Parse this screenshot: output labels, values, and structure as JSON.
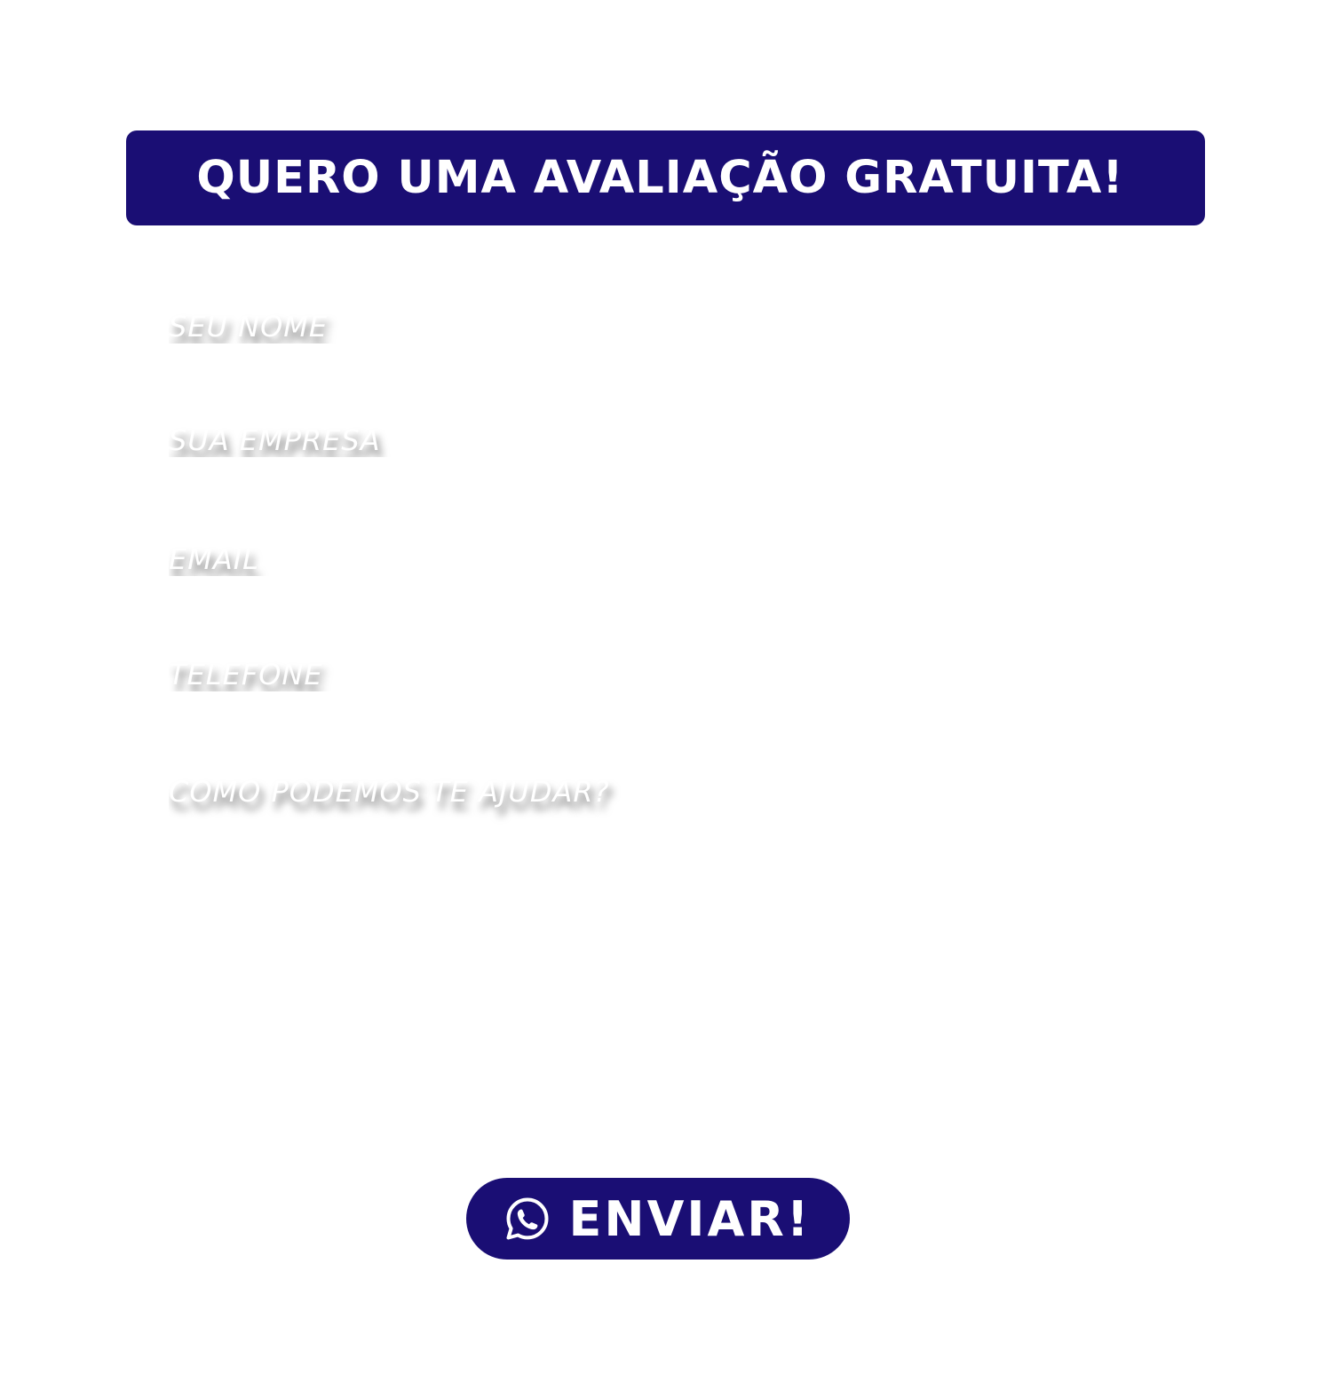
{
  "header": {
    "title": "QUERO UMA AVALIAÇÃO GRATUITA!"
  },
  "form": {
    "name_placeholder": "SEU NOME",
    "company_placeholder": "SUA EMPRESA",
    "email_placeholder": "EMAIL",
    "phone_placeholder": "TELEFONE",
    "message_placeholder": "COMO PODEMOS TE AJUDAR?"
  },
  "submit": {
    "label": "ENVIAR!",
    "icon": "whatsapp-icon"
  },
  "colors": {
    "accent": "#1a0e74",
    "background": "#ffffff",
    "text_on_accent": "#ffffff"
  }
}
